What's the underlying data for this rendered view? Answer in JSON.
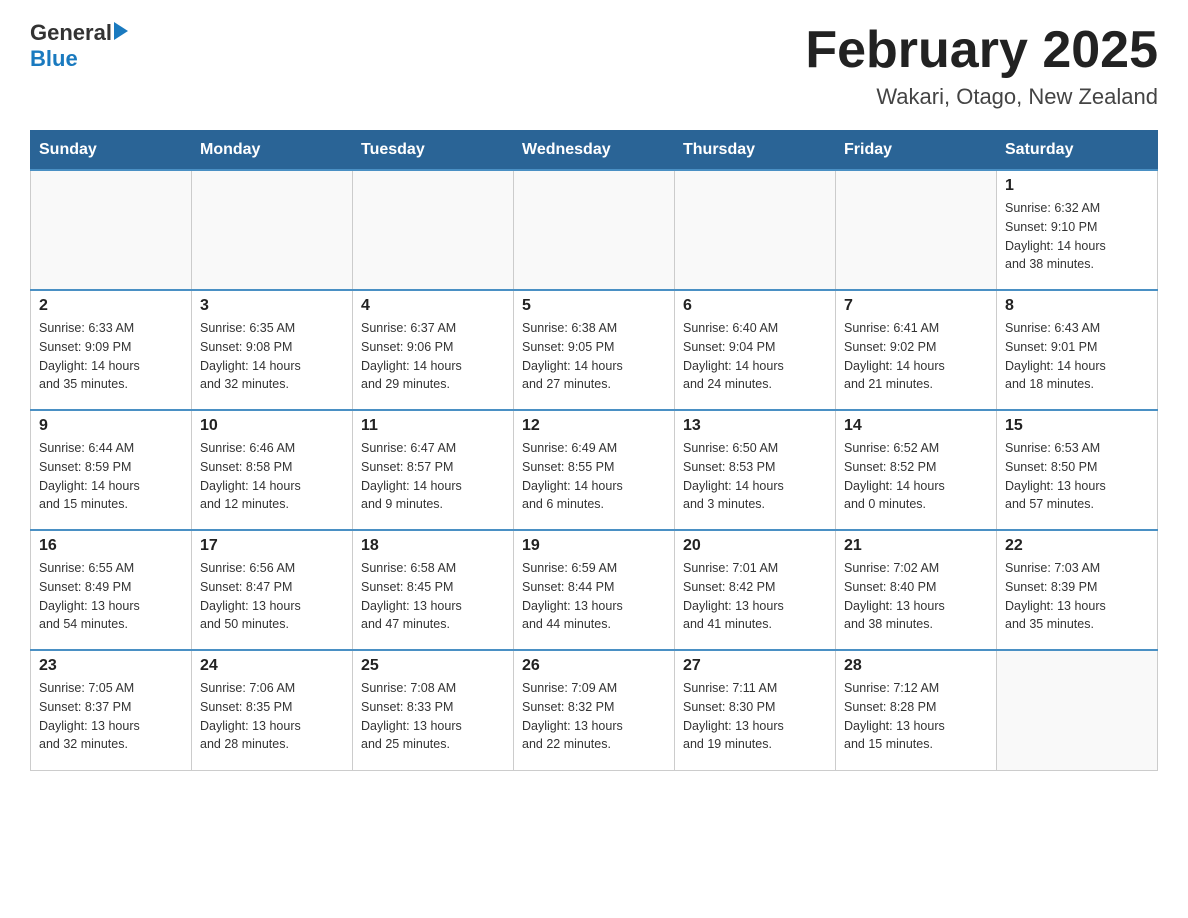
{
  "header": {
    "logo_general": "General",
    "logo_blue": "Blue",
    "title": "February 2025",
    "location": "Wakari, Otago, New Zealand"
  },
  "weekdays": [
    "Sunday",
    "Monday",
    "Tuesday",
    "Wednesday",
    "Thursday",
    "Friday",
    "Saturday"
  ],
  "weeks": [
    [
      {
        "day": "",
        "info": ""
      },
      {
        "day": "",
        "info": ""
      },
      {
        "day": "",
        "info": ""
      },
      {
        "day": "",
        "info": ""
      },
      {
        "day": "",
        "info": ""
      },
      {
        "day": "",
        "info": ""
      },
      {
        "day": "1",
        "info": "Sunrise: 6:32 AM\nSunset: 9:10 PM\nDaylight: 14 hours\nand 38 minutes."
      }
    ],
    [
      {
        "day": "2",
        "info": "Sunrise: 6:33 AM\nSunset: 9:09 PM\nDaylight: 14 hours\nand 35 minutes."
      },
      {
        "day": "3",
        "info": "Sunrise: 6:35 AM\nSunset: 9:08 PM\nDaylight: 14 hours\nand 32 minutes."
      },
      {
        "day": "4",
        "info": "Sunrise: 6:37 AM\nSunset: 9:06 PM\nDaylight: 14 hours\nand 29 minutes."
      },
      {
        "day": "5",
        "info": "Sunrise: 6:38 AM\nSunset: 9:05 PM\nDaylight: 14 hours\nand 27 minutes."
      },
      {
        "day": "6",
        "info": "Sunrise: 6:40 AM\nSunset: 9:04 PM\nDaylight: 14 hours\nand 24 minutes."
      },
      {
        "day": "7",
        "info": "Sunrise: 6:41 AM\nSunset: 9:02 PM\nDaylight: 14 hours\nand 21 minutes."
      },
      {
        "day": "8",
        "info": "Sunrise: 6:43 AM\nSunset: 9:01 PM\nDaylight: 14 hours\nand 18 minutes."
      }
    ],
    [
      {
        "day": "9",
        "info": "Sunrise: 6:44 AM\nSunset: 8:59 PM\nDaylight: 14 hours\nand 15 minutes."
      },
      {
        "day": "10",
        "info": "Sunrise: 6:46 AM\nSunset: 8:58 PM\nDaylight: 14 hours\nand 12 minutes."
      },
      {
        "day": "11",
        "info": "Sunrise: 6:47 AM\nSunset: 8:57 PM\nDaylight: 14 hours\nand 9 minutes."
      },
      {
        "day": "12",
        "info": "Sunrise: 6:49 AM\nSunset: 8:55 PM\nDaylight: 14 hours\nand 6 minutes."
      },
      {
        "day": "13",
        "info": "Sunrise: 6:50 AM\nSunset: 8:53 PM\nDaylight: 14 hours\nand 3 minutes."
      },
      {
        "day": "14",
        "info": "Sunrise: 6:52 AM\nSunset: 8:52 PM\nDaylight: 14 hours\nand 0 minutes."
      },
      {
        "day": "15",
        "info": "Sunrise: 6:53 AM\nSunset: 8:50 PM\nDaylight: 13 hours\nand 57 minutes."
      }
    ],
    [
      {
        "day": "16",
        "info": "Sunrise: 6:55 AM\nSunset: 8:49 PM\nDaylight: 13 hours\nand 54 minutes."
      },
      {
        "day": "17",
        "info": "Sunrise: 6:56 AM\nSunset: 8:47 PM\nDaylight: 13 hours\nand 50 minutes."
      },
      {
        "day": "18",
        "info": "Sunrise: 6:58 AM\nSunset: 8:45 PM\nDaylight: 13 hours\nand 47 minutes."
      },
      {
        "day": "19",
        "info": "Sunrise: 6:59 AM\nSunset: 8:44 PM\nDaylight: 13 hours\nand 44 minutes."
      },
      {
        "day": "20",
        "info": "Sunrise: 7:01 AM\nSunset: 8:42 PM\nDaylight: 13 hours\nand 41 minutes."
      },
      {
        "day": "21",
        "info": "Sunrise: 7:02 AM\nSunset: 8:40 PM\nDaylight: 13 hours\nand 38 minutes."
      },
      {
        "day": "22",
        "info": "Sunrise: 7:03 AM\nSunset: 8:39 PM\nDaylight: 13 hours\nand 35 minutes."
      }
    ],
    [
      {
        "day": "23",
        "info": "Sunrise: 7:05 AM\nSunset: 8:37 PM\nDaylight: 13 hours\nand 32 minutes."
      },
      {
        "day": "24",
        "info": "Sunrise: 7:06 AM\nSunset: 8:35 PM\nDaylight: 13 hours\nand 28 minutes."
      },
      {
        "day": "25",
        "info": "Sunrise: 7:08 AM\nSunset: 8:33 PM\nDaylight: 13 hours\nand 25 minutes."
      },
      {
        "day": "26",
        "info": "Sunrise: 7:09 AM\nSunset: 8:32 PM\nDaylight: 13 hours\nand 22 minutes."
      },
      {
        "day": "27",
        "info": "Sunrise: 7:11 AM\nSunset: 8:30 PM\nDaylight: 13 hours\nand 19 minutes."
      },
      {
        "day": "28",
        "info": "Sunrise: 7:12 AM\nSunset: 8:28 PM\nDaylight: 13 hours\nand 15 minutes."
      },
      {
        "day": "",
        "info": ""
      }
    ]
  ]
}
